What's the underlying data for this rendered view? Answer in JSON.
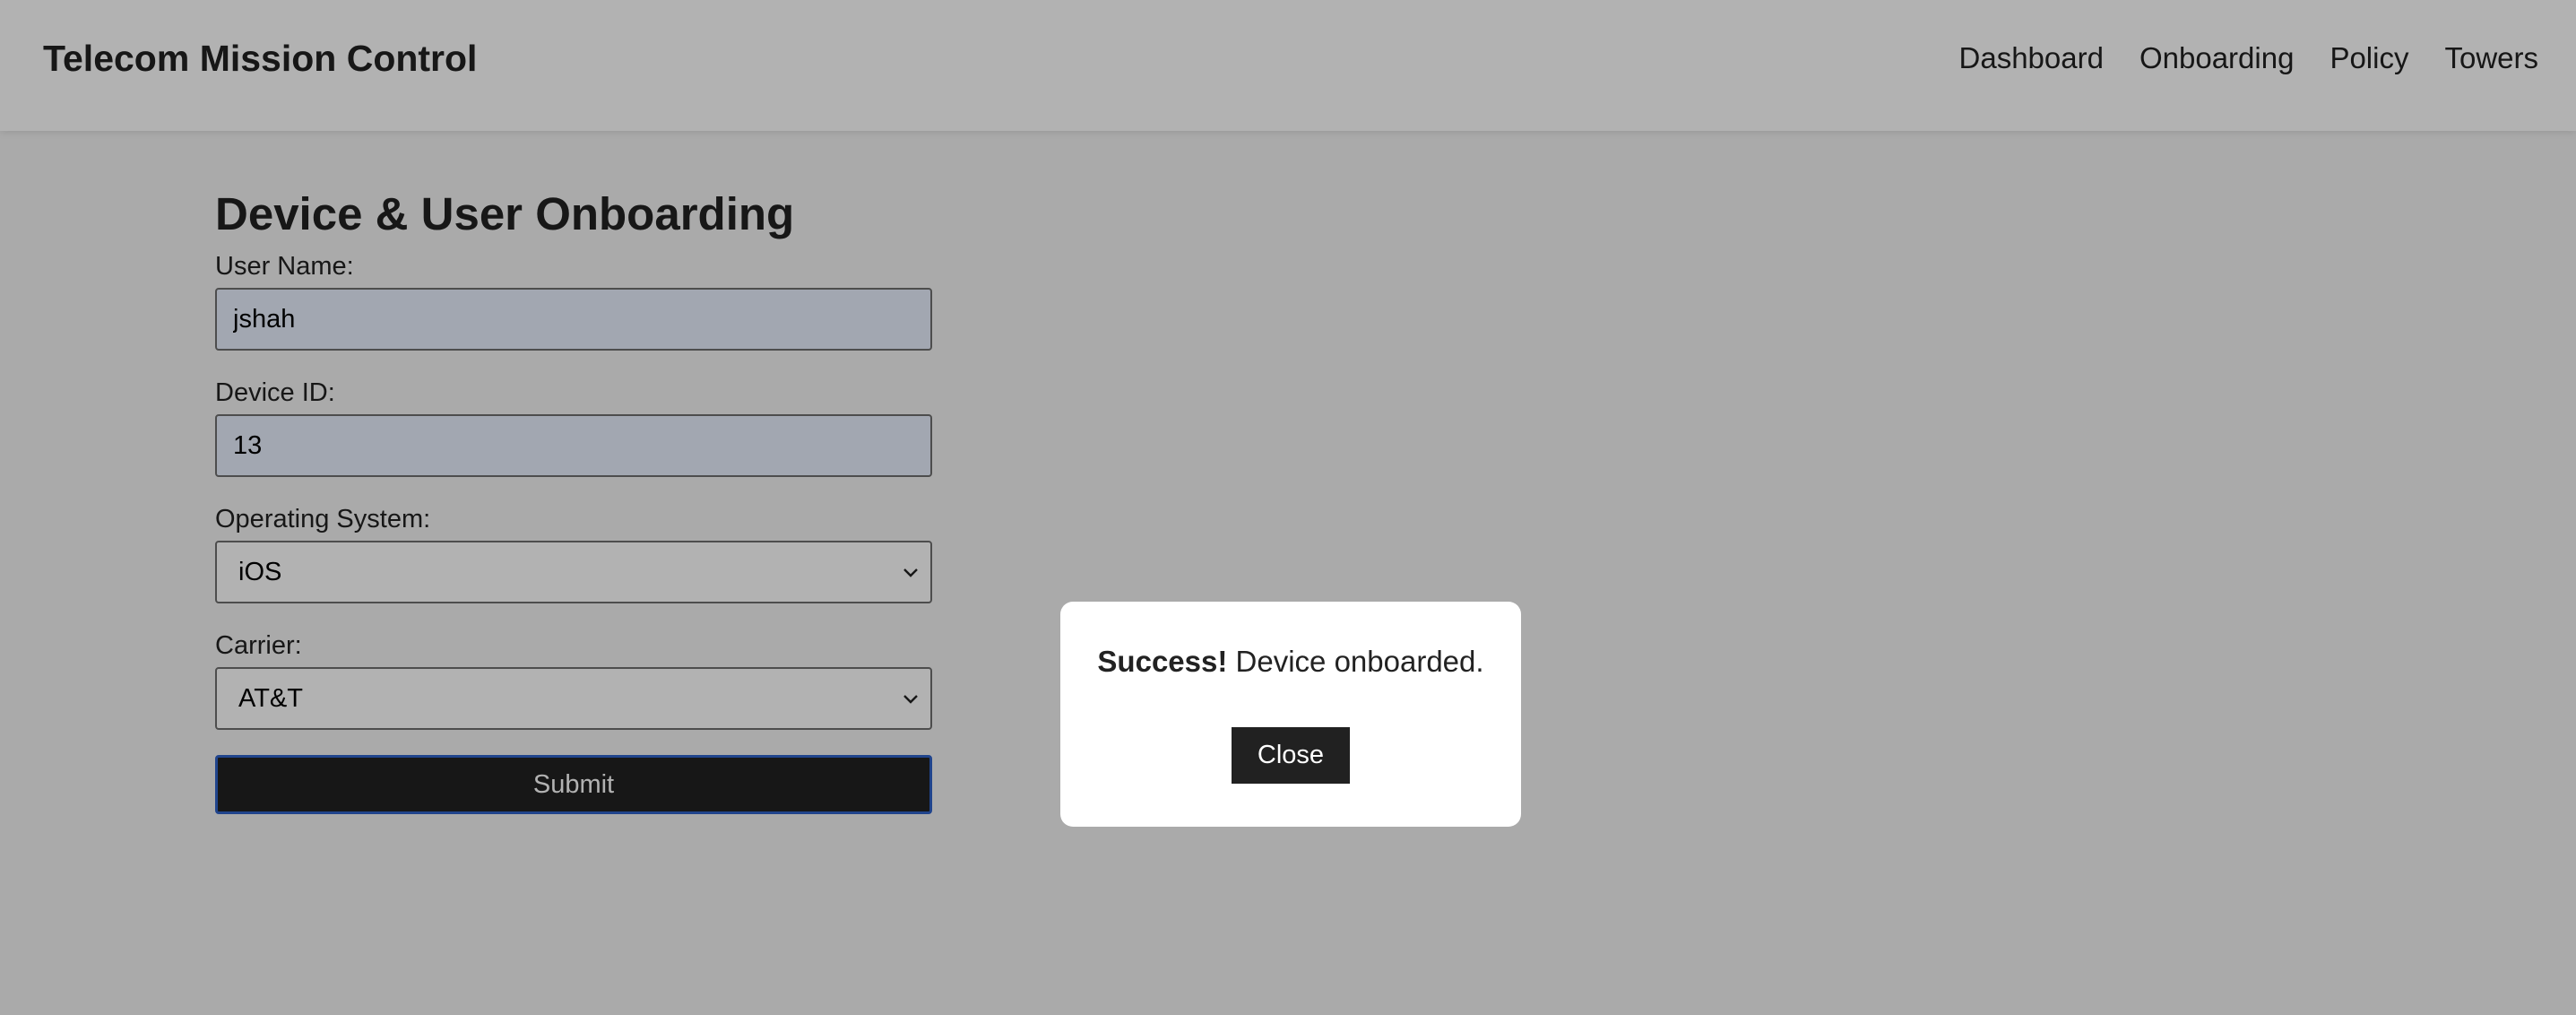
{
  "header": {
    "title": "Telecom Mission Control",
    "nav": [
      "Dashboard",
      "Onboarding",
      "Policy",
      "Towers"
    ]
  },
  "form": {
    "title": "Device & User Onboarding",
    "user_name": {
      "label": "User Name:",
      "value": "jshah"
    },
    "device_id": {
      "label": "Device ID:",
      "value": "13"
    },
    "operating_system": {
      "label": "Operating System:",
      "value": "iOS"
    },
    "carrier": {
      "label": "Carrier:",
      "value": "AT&T"
    },
    "submit_label": "Submit"
  },
  "modal": {
    "status": "Success!",
    "message": " Device onboarded.",
    "close_label": "Close"
  },
  "icons": {
    "select_arrow": "chevron-down-icon"
  },
  "colors": {
    "header_bg": "#ffffff",
    "page_bg": "#f4f4f4",
    "input_autofill_bg": "#e8f0fe",
    "button_bg": "#212121",
    "focus_ring": "#2f62c9",
    "overlay": "rgba(0,0,0,0.30)"
  }
}
